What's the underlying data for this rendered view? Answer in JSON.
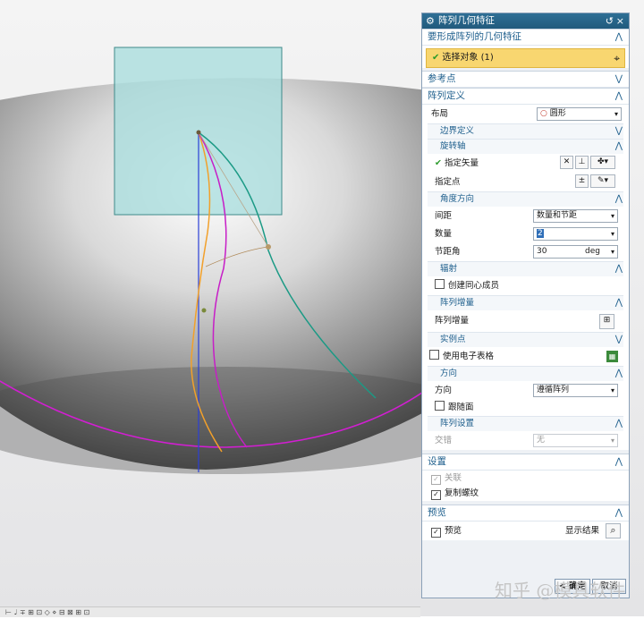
{
  "dialog": {
    "title": "阵列几何特征",
    "sections": {
      "object": {
        "header": "要形成阵列的几何特征",
        "select_label": "选择对象 (1)"
      },
      "ref": {
        "header": "参考点"
      },
      "pattern": {
        "header": "阵列定义",
        "layout_label": "布局",
        "layout_value": "圆形",
        "boundary": "边界定义",
        "rotation_axis": "旋转轴",
        "specify_vector": "指定矢量",
        "specify_point": "指定点",
        "angle_dir": "角度方向",
        "spacing_label": "间距",
        "spacing_value": "数量和节距",
        "count_label": "数量",
        "count_value": "2",
        "pitch_label": "节距角",
        "pitch_value": "30",
        "pitch_unit": "deg",
        "radiate": "辐射",
        "concentric": "创建同心成员",
        "increment_header": "阵列增量",
        "increment_label": "阵列增量",
        "instance": "实例点",
        "spreadsheet": "使用电子表格",
        "orientation": "方向",
        "orientation_label": "方向",
        "orientation_value": "遵循阵列",
        "follow_face": "跟随面",
        "pattern_settings": "阵列设置",
        "stagger_label": "交错",
        "stagger_value": "无"
      },
      "settings": {
        "header": "设置",
        "associative": "关联",
        "copy_threads": "复制螺纹"
      },
      "preview": {
        "header": "预览",
        "preview_label": "预览",
        "show_result": "显示结果"
      }
    },
    "buttons": {
      "ok": "< 确定 >",
      "cancel": "取消"
    }
  },
  "watermark": "知乎 @模具软件",
  "statusbar": "⊢ ♩ ∓ ⊞ ⊡ ◇ ⋄ ⊟ ⊠ ⊞ ⊡"
}
